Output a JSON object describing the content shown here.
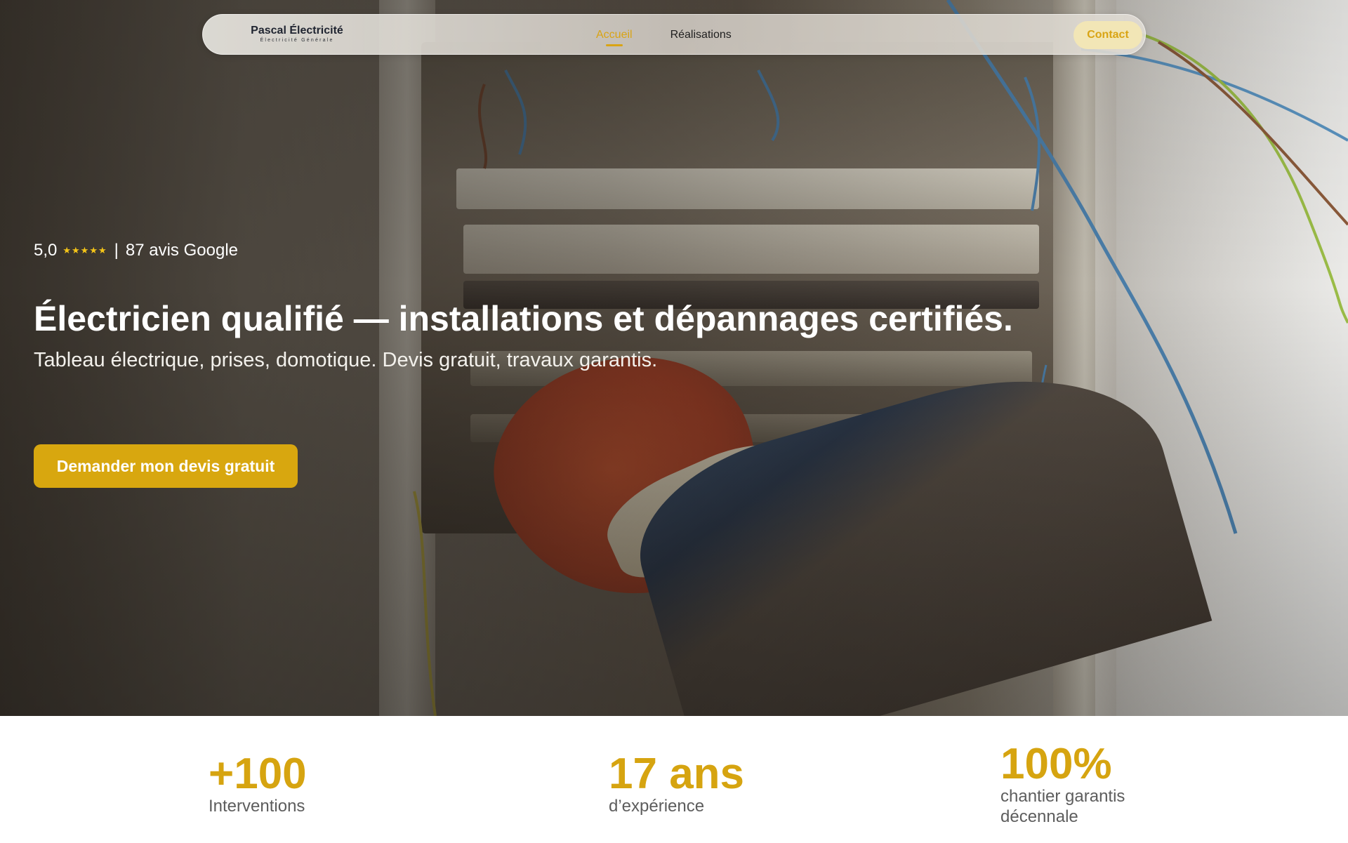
{
  "brand": {
    "name": "Pascal Électricité",
    "tagline": "Électricité Générale"
  },
  "nav": {
    "links": [
      {
        "label": "Accueil",
        "active": true
      },
      {
        "label": "Réalisations",
        "active": false
      }
    ],
    "contact_label": "Contact"
  },
  "hero": {
    "rating_score": "5,0",
    "rating_stars": "★★★★★",
    "rating_separator": "|",
    "rating_reviews": "87 avis Google",
    "headline": "Électricien qualifié — installations et dépannages certifiés.",
    "subline": "Tableau électrique, prises, domotique. Devis gratuit, travaux garantis.",
    "cta_label": "Demander mon devis gratuit"
  },
  "stats": [
    {
      "value": "+100",
      "label": "Interventions"
    },
    {
      "value": "17 ans",
      "label": "d’expérience"
    },
    {
      "value": "100%",
      "label": "chantier garantis décennale"
    }
  ],
  "colors": {
    "accent": "#d8a70f",
    "nav_bg": "#e4e0d8",
    "text_dark": "#1f1f1f",
    "stat_label": "#5d5d5d"
  },
  "icons": {
    "rating": "star-icon"
  }
}
